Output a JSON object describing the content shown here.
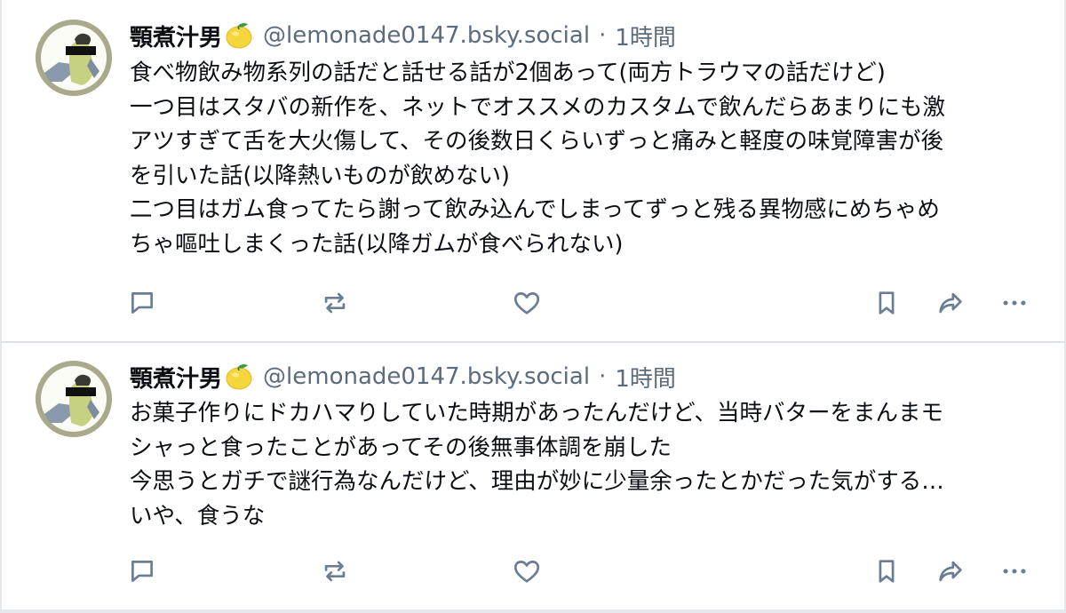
{
  "colors": {
    "text_primary": "#0b0f14",
    "text_secondary": "#5b6b7c",
    "icon": "#6a7d92",
    "divider": "#e5e8ec"
  },
  "posts": [
    {
      "author": {
        "display_name": "顎煮汁男",
        "emoji_icon": "lemon-icon",
        "handle": "@lemonade0147.bsky.social"
      },
      "separator": "·",
      "timestamp": "1時間",
      "lines": [
        "食べ物飲み物系列の話だと話せる話が2個あって(両方トラウマの話だけど)",
        "一つ目はスタバの新作を、ネットでオススメのカスタムで飲んだらあまりにも激",
        "アツすぎて舌を大火傷して、その後数日くらいずっと痛みと軽度の味覚障害が後",
        "を引いた話(以降熱いものが飲めない)",
        "二つ目はガム食ってたら謝って飲み込んでしまってずっと残る異物感にめちゃめ",
        "ちゃ嘔吐しまくった話(以降ガムが食べられない)"
      ],
      "actions": [
        "reply-icon",
        "repost-icon",
        "like-icon",
        "bookmark-icon",
        "share-icon",
        "more-icon"
      ]
    },
    {
      "author": {
        "display_name": "顎煮汁男",
        "emoji_icon": "lemon-icon",
        "handle": "@lemonade0147.bsky.social"
      },
      "separator": "·",
      "timestamp": "1時間",
      "lines": [
        "お菓子作りにドカハマりしていた時期があったんだけど、当時バターをまんまモ",
        "シャっと食ったことがあってその後無事体調を崩した",
        "今思うとガチで謎行為なんだけど、理由が妙に少量余ったとかだった気がする…",
        "いや、食うな"
      ],
      "actions": [
        "reply-icon",
        "repost-icon",
        "like-icon",
        "bookmark-icon",
        "share-icon",
        "more-icon"
      ]
    }
  ]
}
